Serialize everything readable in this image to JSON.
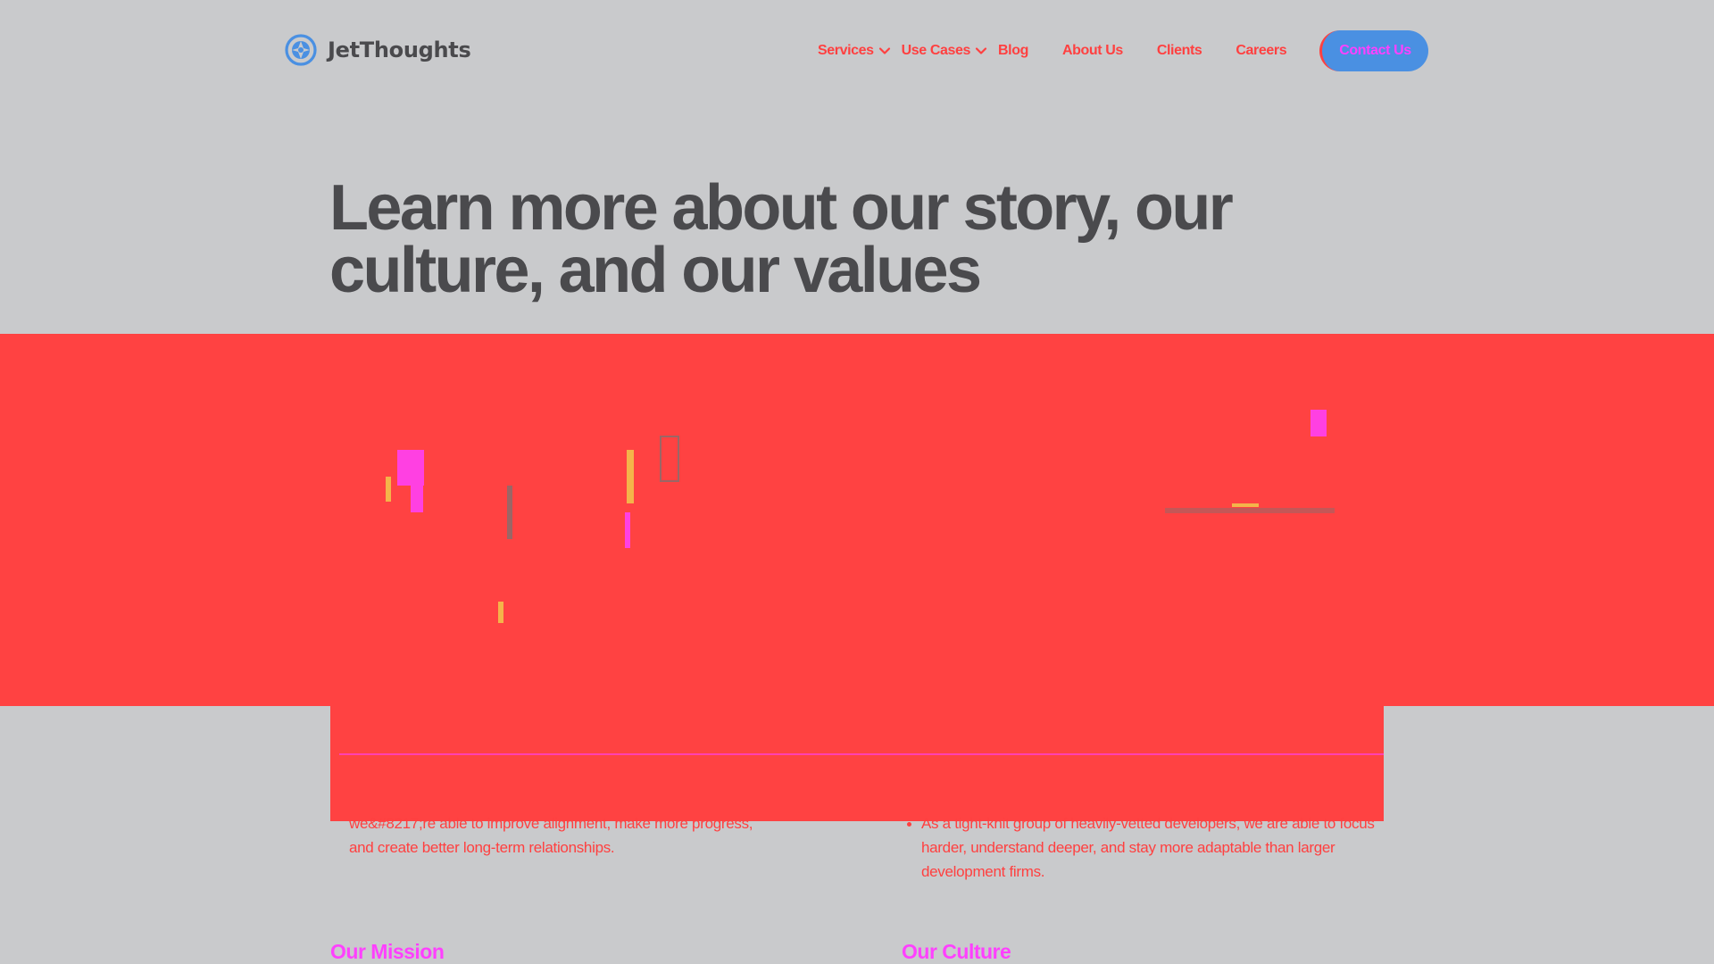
{
  "header": {
    "logo_text": "JetThoughts",
    "nav": [
      {
        "label": "Services",
        "has_dropdown": true
      },
      {
        "label": "Use Cases",
        "has_dropdown": true
      },
      {
        "label": "Blog",
        "has_dropdown": false
      },
      {
        "label": "About Us",
        "has_dropdown": false
      },
      {
        "label": "Clients",
        "has_dropdown": false
      },
      {
        "label": "Careers",
        "has_dropdown": false
      }
    ],
    "cta_label": "Contact Us"
  },
  "hero": {
    "title_line1": "Learn more about our story, our",
    "title_line2": "culture, and our values"
  },
  "lists": {
    "left": [
      "we&#8217;re able to improve alignment, make more progress,",
      "and create better long-term relationships."
    ],
    "right": [
      "As a tight-knit group of heavily-vetted developers, we are able to focus harder, understand deeper, and stay more adaptable than larger development firms."
    ]
  },
  "sections": {
    "mission_heading": "Our Mission",
    "culture_heading": "Our Culture"
  },
  "colors": {
    "background": "#c9cacc",
    "heading_text": "#4a4a4d",
    "accent_red": "#ff4040",
    "accent_magenta": "#ff40ff",
    "brand_blue": "#4a90e2"
  },
  "icons": {
    "logo": "jetthoughts-logo-icon",
    "dropdown": "chevron-down-icon"
  }
}
